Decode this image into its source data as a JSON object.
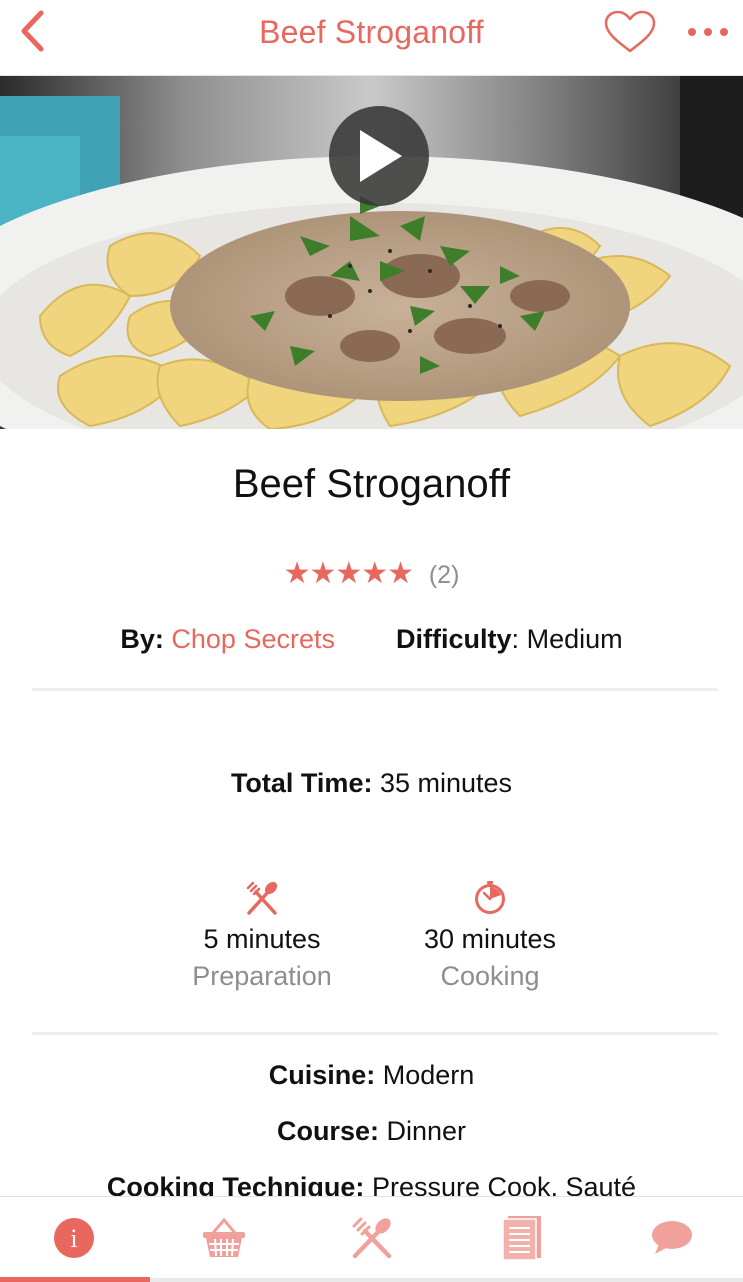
{
  "nav": {
    "title": "Beef Stroganoff",
    "back_icon": "chevron-left-icon",
    "favorite_icon": "heart-outline-icon",
    "more_icon": "ellipsis-icon"
  },
  "hero": {
    "play_icon": "play-icon"
  },
  "recipe": {
    "title": "Beef Stroganoff",
    "stars": "★★★★★",
    "rating_count": "(2)",
    "by_label": "By:",
    "author": "Chop Secrets",
    "difficulty_label": "Difficulty",
    "difficulty_sep": ":",
    "difficulty": "Medium",
    "total_time_label": "Total Time:",
    "total_time": "35 minutes",
    "prep": {
      "value": "5 minutes",
      "label": "Preparation",
      "icon": "utensils-icon"
    },
    "cook": {
      "value": "30 minutes",
      "label": "Cooking",
      "icon": "timer-icon"
    },
    "cuisine_label": "Cuisine:",
    "cuisine": "Modern",
    "course_label": "Course:",
    "course": "Dinner",
    "technique_label": "Cooking Technique:",
    "technique": "Pressure Cook, Sauté"
  },
  "tabs": [
    {
      "name": "info",
      "icon": "info-icon",
      "active": true
    },
    {
      "name": "ingredients",
      "icon": "basket-icon",
      "active": false
    },
    {
      "name": "cook",
      "icon": "utensils-icon",
      "active": false
    },
    {
      "name": "directions",
      "icon": "document-icon",
      "active": false
    },
    {
      "name": "reviews",
      "icon": "chat-bubble-icon",
      "active": false
    }
  ],
  "colors": {
    "accent": "#e8675f",
    "muted_text": "#8e8e8e",
    "divider": "#eeeeee"
  }
}
